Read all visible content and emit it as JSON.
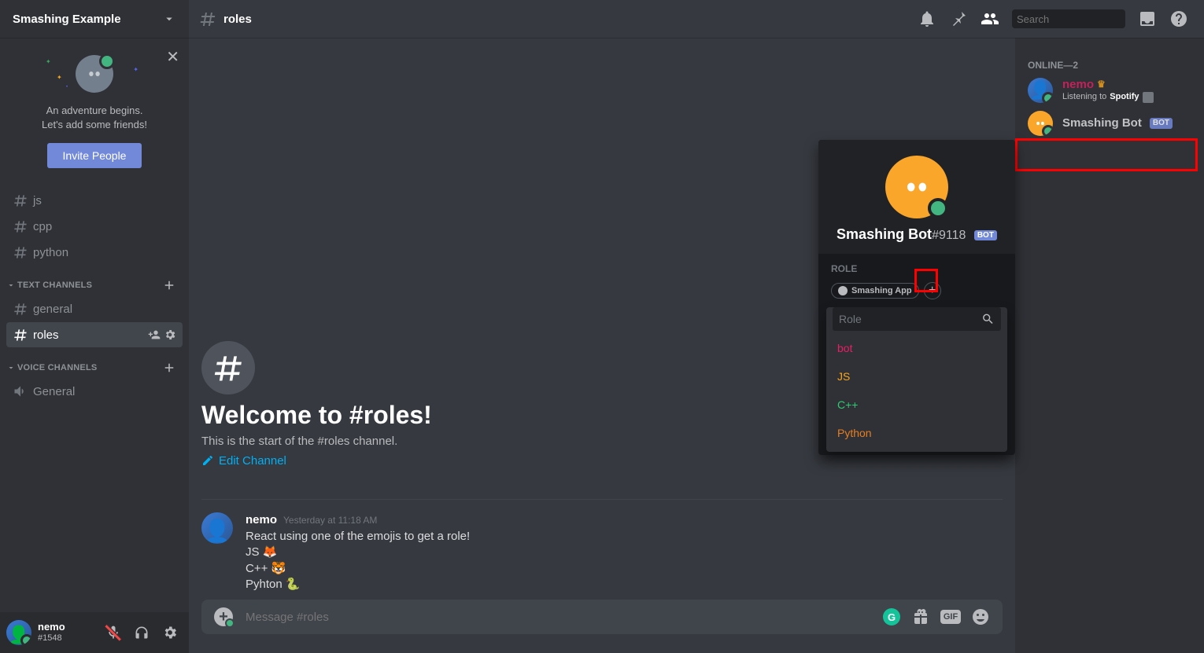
{
  "server": {
    "name": "Smashing Example"
  },
  "inviteCard": {
    "line1": "An adventure begins.",
    "line2": "Let's add some friends!",
    "button": "Invite People"
  },
  "categories": {
    "uncategorized": [
      "js",
      "cpp",
      "python"
    ],
    "text": {
      "label": "Text Channels",
      "channels": [
        "general",
        "roles"
      ],
      "active": "roles"
    },
    "voice": {
      "label": "Voice Channels",
      "channels": [
        "General"
      ]
    }
  },
  "currentUser": {
    "name": "nemo",
    "tag": "#1548"
  },
  "header": {
    "channel": "roles",
    "searchPlaceholder": "Search"
  },
  "welcome": {
    "title": "Welcome to #roles!",
    "subtitle": "This is the start of the #roles channel.",
    "editLabel": "Edit Channel"
  },
  "message": {
    "author": "nemo",
    "timestamp": "Yesterday at 11:18 AM",
    "l1": "React using one of the emojis to get a role!",
    "l2": "JS 🦊",
    "l3": "C++ 🐯",
    "l4": "Pyhton 🐍"
  },
  "composer": {
    "placeholder": "Message #roles",
    "gifLabel": "GIF"
  },
  "popout": {
    "name": "Smashing Bot",
    "discriminator": "#9118",
    "botTag": "BOT",
    "roleLabel": "Role",
    "roleChip": "Smashing App",
    "searchPlaceholder": "Role",
    "options": {
      "bot": "bot",
      "js": "JS",
      "cpp": "C++",
      "py": "Python"
    }
  },
  "members": {
    "groupLabel": "Online—2",
    "nemo": {
      "name": "nemo",
      "status_prefix": "Listening to ",
      "status_bold": "Spotify"
    },
    "bot": {
      "name": "Smashing Bot",
      "tag": "BOT"
    }
  }
}
